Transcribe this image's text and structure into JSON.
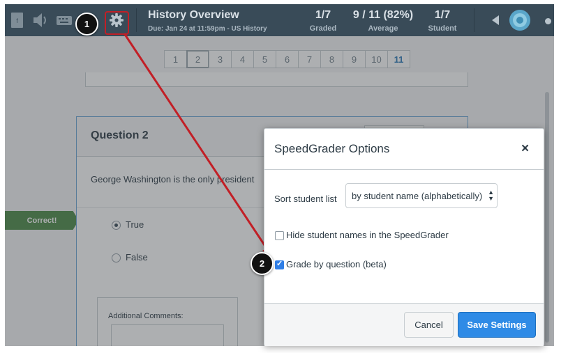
{
  "topbar": {
    "title": "History Overview",
    "due": "Due: Jan 24 at 11:59pm - US History",
    "stats": [
      {
        "value": "1/7",
        "label": "Graded"
      },
      {
        "value": "9 / 11 (82%)",
        "label": "Average"
      },
      {
        "value": "1/7",
        "label": "Student"
      }
    ]
  },
  "pager": {
    "pages": [
      "1",
      "2",
      "3",
      "4",
      "5",
      "6",
      "7",
      "8",
      "9",
      "10",
      "11"
    ],
    "selected": "2",
    "highlighted": "11"
  },
  "question": {
    "title": "Question 2",
    "text": "George Washington is the only president",
    "answers": [
      "True",
      "False"
    ],
    "selected_answer": "True",
    "correct_label": "Correct!",
    "comments_label": "Additional Comments:"
  },
  "modal": {
    "title": "SpeedGrader Options",
    "close": "×",
    "sort_label": "Sort student list",
    "sort_value": "by student name (alphabetically)",
    "hide_names_label": "Hide student names in the SpeedGrader",
    "hide_names_checked": false,
    "grade_by_question_label": "Grade by question (beta)",
    "grade_by_question_checked": true,
    "cancel_label": "Cancel",
    "save_label": "Save Settings"
  },
  "callouts": [
    "1",
    "2"
  ],
  "colors": {
    "topbar": "#394b58",
    "primary_button": "#2f8be6",
    "correct_badge": "#4d8a47",
    "annotation": "#c21f26"
  },
  "icons": [
    "document-icon",
    "speaker-icon",
    "keyboard-icon",
    "gear-icon",
    "prev-arrow-icon",
    "avatar-icon",
    "close-icon"
  ]
}
